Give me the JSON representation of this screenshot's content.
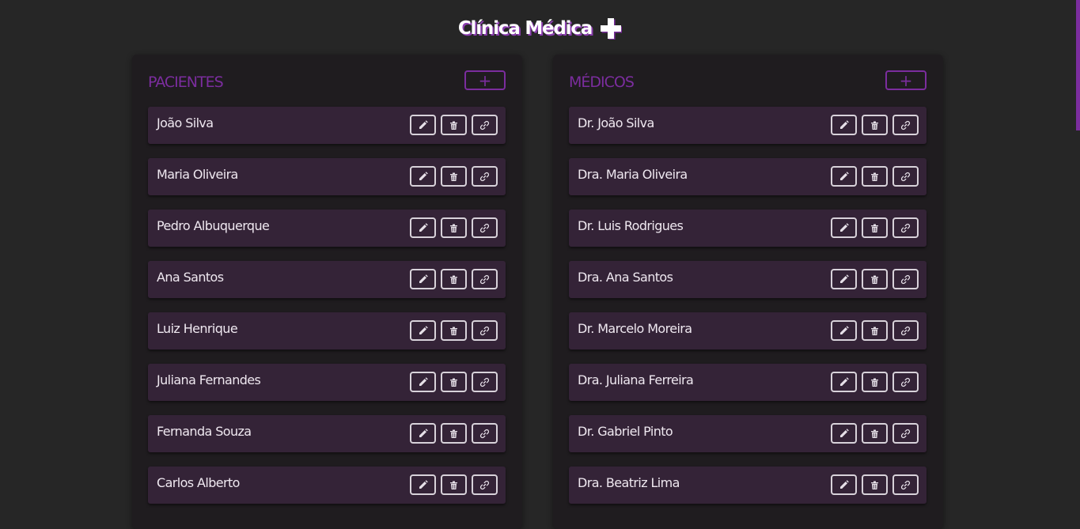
{
  "app": {
    "title": "Clínica Médica",
    "icon": "plus-cross-icon"
  },
  "colors": {
    "background": "#262626",
    "panel": "#1f1c1f",
    "item": "#342337",
    "accent": "#7b2d9e",
    "text": "#efe8f0"
  },
  "patients": {
    "title": "PACIENTES",
    "add_label": "+",
    "items": [
      {
        "name": "João Silva"
      },
      {
        "name": "Maria Oliveira"
      },
      {
        "name": "Pedro Albuquerque"
      },
      {
        "name": "Ana Santos"
      },
      {
        "name": "Luiz Henrique"
      },
      {
        "name": "Juliana Fernandes"
      },
      {
        "name": "Fernanda Souza"
      },
      {
        "name": "Carlos Alberto"
      }
    ]
  },
  "doctors": {
    "title": "MÉDICOS",
    "add_label": "+",
    "items": [
      {
        "name": "Dr. João Silva"
      },
      {
        "name": "Dra. Maria Oliveira"
      },
      {
        "name": "Dr. Luis Rodrigues"
      },
      {
        "name": "Dra. Ana Santos"
      },
      {
        "name": "Dr. Marcelo Moreira"
      },
      {
        "name": "Dra. Juliana Ferreira"
      },
      {
        "name": "Dr. Gabriel Pinto"
      },
      {
        "name": "Dra. Beatriz Lima"
      }
    ]
  },
  "item_actions": [
    "pencil-icon",
    "trash-icon",
    "link-icon"
  ]
}
